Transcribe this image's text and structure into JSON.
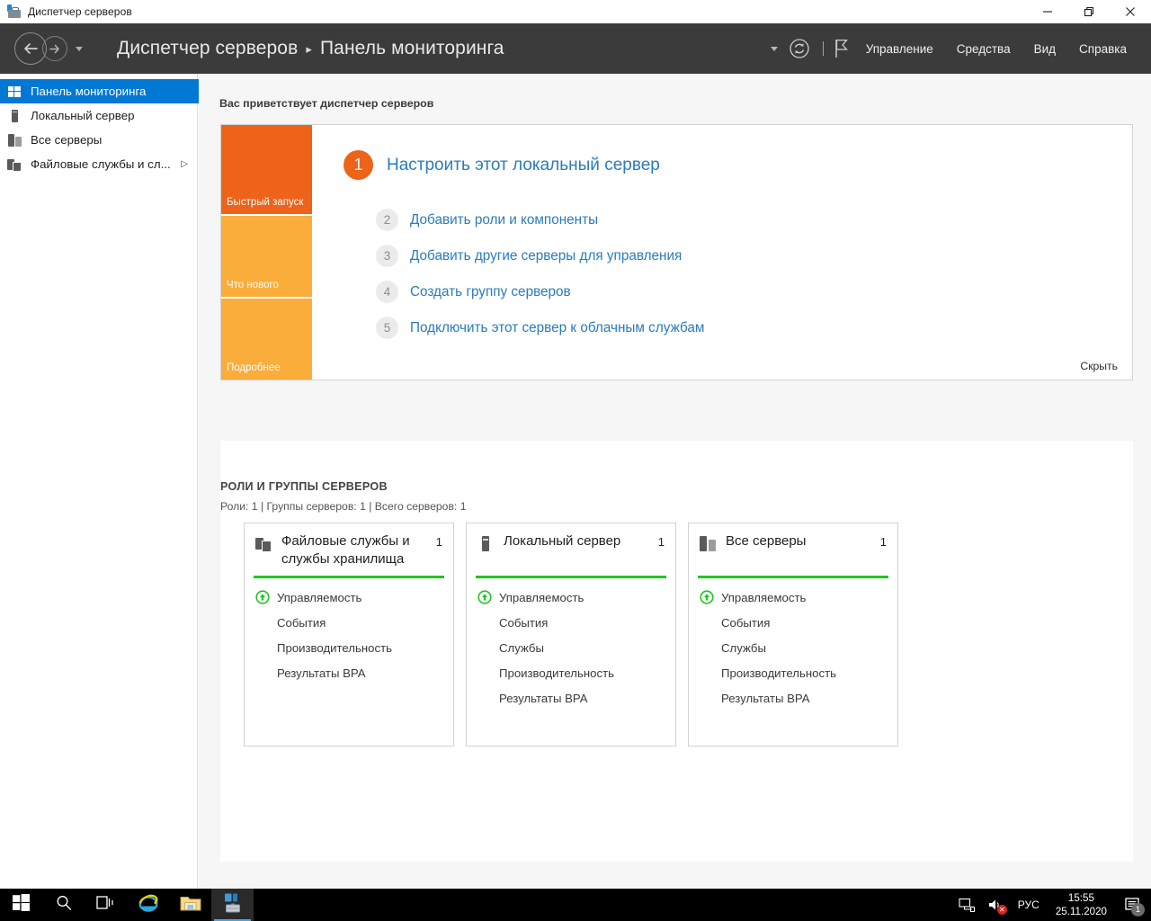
{
  "window": {
    "title": "Диспетчер серверов",
    "icon": "server-manager-icon",
    "controls": {
      "minimize": "minimize-icon",
      "restore": "restore-icon",
      "close": "close-icon"
    }
  },
  "header": {
    "back": "back-arrow-icon",
    "forward": "forward-arrow-icon",
    "history_caret": "chevron-down-icon",
    "breadcrumb": {
      "root": "Диспетчер серверов",
      "separator": "▸",
      "current": "Панель мониторинга"
    },
    "refresh_icon": "refresh-icon",
    "flag_icon": "flag-icon",
    "menu": [
      {
        "label": "Управление"
      },
      {
        "label": "Средства"
      },
      {
        "label": "Вид"
      },
      {
        "label": "Справка"
      }
    ]
  },
  "sidebar": {
    "items": [
      {
        "label": "Панель мониторинга",
        "icon": "dashboard-icon",
        "selected": true,
        "expandable": false
      },
      {
        "label": "Локальный сервер",
        "icon": "server-icon",
        "selected": false,
        "expandable": false
      },
      {
        "label": "Все серверы",
        "icon": "servers-icon",
        "selected": false,
        "expandable": false
      },
      {
        "label": "Файловые службы и сл...",
        "icon": "file-services-icon",
        "selected": false,
        "expandable": true,
        "arrow": "▷"
      }
    ]
  },
  "main": {
    "welcome_label": "Вас приветствует диспетчер серверов",
    "tiles": [
      {
        "label": "Быстрый запуск",
        "color": "#ec6319"
      },
      {
        "label": "Что нового",
        "color": "#fbad3c"
      },
      {
        "label": "Подробнее",
        "color": "#fbad3c"
      }
    ],
    "quick_start": [
      {
        "num": "1",
        "text": "Настроить этот локальный сервер",
        "primary": true
      },
      {
        "num": "2",
        "text": "Добавить роли и компоненты",
        "primary": false
      },
      {
        "num": "3",
        "text": "Добавить другие серверы для управления",
        "primary": false
      },
      {
        "num": "4",
        "text": "Создать группу серверов",
        "primary": false
      },
      {
        "num": "5",
        "text": "Подключить этот сервер к облачным службам",
        "primary": false
      }
    ],
    "hide_link": "Скрыть",
    "roles": {
      "heading": "РОЛИ И ГРУППЫ СЕРВЕРОВ",
      "summary": "Роли: 1 | Группы серверов: 1 | Всего серверов: 1",
      "cards": [
        {
          "title": "Файловые службы и службы хранилища",
          "count": "1",
          "icon": "file-services-icon",
          "rule_color": "#23c423",
          "rows": [
            {
              "label": "Управляемость",
              "status": "ok-up-icon"
            },
            {
              "label": "События",
              "status": null
            },
            {
              "label": "Производительность",
              "status": null
            },
            {
              "label": "Результаты BPA",
              "status": null
            }
          ]
        },
        {
          "title": "Локальный сервер",
          "count": "1",
          "icon": "server-icon",
          "rule_color": "#23c423",
          "rows": [
            {
              "label": "Управляемость",
              "status": "ok-up-icon"
            },
            {
              "label": "События",
              "status": null
            },
            {
              "label": "Службы",
              "status": null
            },
            {
              "label": "Производительность",
              "status": null
            },
            {
              "label": "Результаты BPA",
              "status": null
            }
          ]
        },
        {
          "title": "Все серверы",
          "count": "1",
          "icon": "servers-icon",
          "rule_color": "#23c423",
          "rows": [
            {
              "label": "Управляемость",
              "status": "ok-up-icon"
            },
            {
              "label": "События",
              "status": null
            },
            {
              "label": "Службы",
              "status": null
            },
            {
              "label": "Производительность",
              "status": null
            },
            {
              "label": "Результаты BPA",
              "status": null
            }
          ]
        }
      ]
    }
  },
  "taskbar": {
    "buttons": [
      {
        "name": "start-button",
        "icon": "windows-logo-icon",
        "active": false
      },
      {
        "name": "search-button",
        "icon": "search-icon",
        "active": false
      },
      {
        "name": "task-view-button",
        "icon": "task-view-icon",
        "active": false
      },
      {
        "name": "internet-explorer-button",
        "icon": "internet-explorer-icon",
        "active": false
      },
      {
        "name": "file-explorer-button",
        "icon": "folder-icon",
        "active": false
      },
      {
        "name": "server-manager-button",
        "icon": "server-manager-icon",
        "active": true
      }
    ],
    "tray": {
      "network_icon": "network-icon",
      "volume_icon": "volume-muted-icon",
      "language": "РУС",
      "time": "15:55",
      "date": "25.11.2020",
      "notifications_icon": "notification-icon",
      "notifications_count": "1"
    }
  },
  "colors": {
    "accent_blue": "#0078d4",
    "link_blue": "#2b7cb9",
    "header_dark": "#3b3b3b",
    "tile_orange": "#ec6319",
    "tile_amber": "#fbad3c",
    "status_green": "#23c423"
  }
}
